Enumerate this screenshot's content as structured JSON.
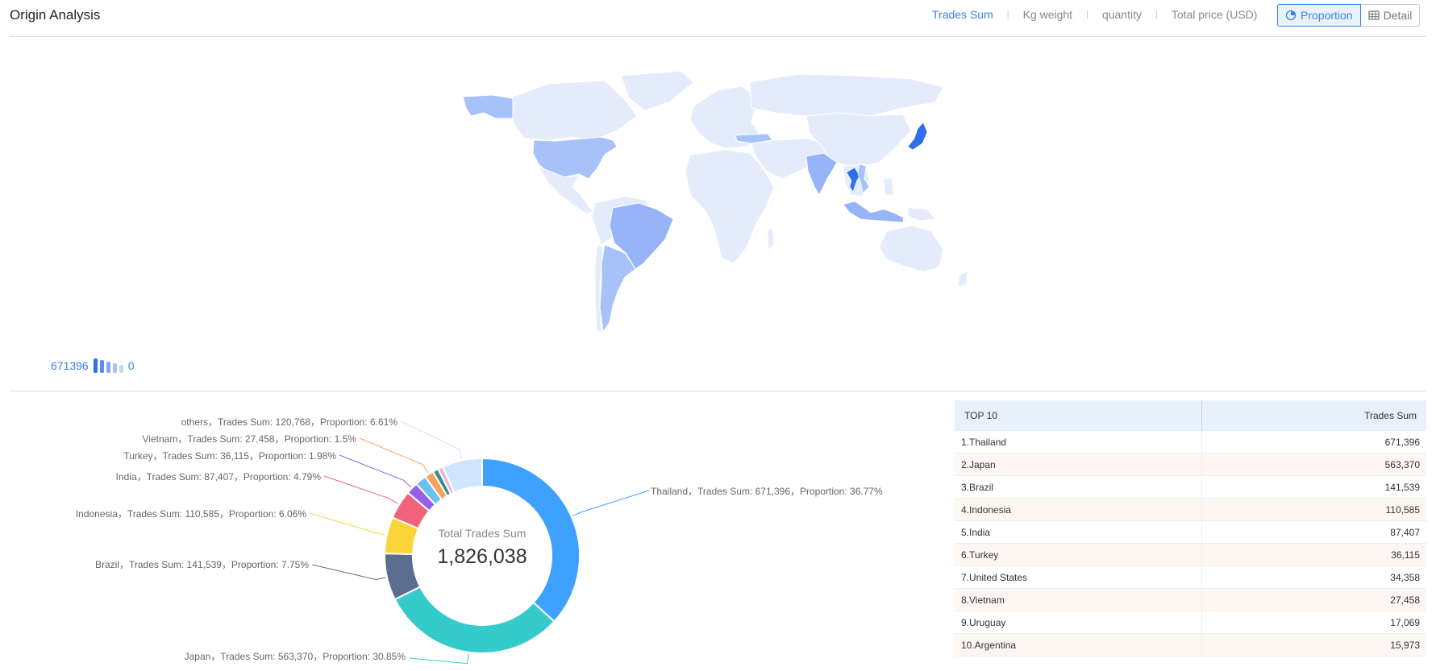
{
  "header": {
    "title": "Origin Analysis",
    "metric_tabs": [
      "Trades Sum",
      "Kg weight",
      "quantity",
      "Total price (USD)"
    ],
    "view_buttons": [
      "Proportion",
      "Detail"
    ]
  },
  "map": {
    "legend_max": "671396",
    "legend_min": "0",
    "highlighted_countries": [
      "Thailand",
      "Japan",
      "Brazil",
      "Indonesia",
      "India",
      "Turkey",
      "United States",
      "Vietnam",
      "Uruguay",
      "Argentina"
    ]
  },
  "donut": {
    "center_label": "Total Trades Sum",
    "center_value": "1,826,038",
    "labels": [
      "Thailand，Trades Sum: 671,396，Proportion: 36.77%",
      "Japan，Trades Sum: 563,370，Proportion: 30.85%",
      "Brazil，Trades Sum: 141,539，Proportion: 7.75%",
      "Indonesia，Trades Sum: 110,585，Proportion: 6.06%",
      "India，Trades Sum: 87,407，Proportion: 4.79%",
      "Turkey，Trades Sum: 36,115，Proportion: 1.98%",
      "Vietnam，Trades Sum: 27,458，Proportion: 1.5%",
      "others，Trades Sum: 120,768，Proportion: 6.61%"
    ]
  },
  "chart_data": {
    "type": "pie",
    "title": "Total Trades Sum",
    "total": 1826038,
    "slices": [
      {
        "name": "Thailand",
        "value": 671396,
        "proportion": 36.77,
        "color": "#3fa1ff"
      },
      {
        "name": "Japan",
        "value": 563370,
        "proportion": 30.85,
        "color": "#36cbcb"
      },
      {
        "name": "Brazil",
        "value": 141539,
        "proportion": 7.75,
        "color": "#5b6e8f"
      },
      {
        "name": "Indonesia",
        "value": 110585,
        "proportion": 6.06,
        "color": "#fbd437"
      },
      {
        "name": "India",
        "value": 87407,
        "proportion": 4.79,
        "color": "#f2637b"
      },
      {
        "name": "Turkey",
        "value": 36115,
        "proportion": 1.98,
        "color": "#975fe5"
      },
      {
        "name": "United States",
        "value": 34358,
        "proportion": 1.88,
        "color": "#6bc1f0"
      },
      {
        "name": "Vietnam",
        "value": 27458,
        "proportion": 1.5,
        "color": "#f7a35c"
      },
      {
        "name": "Uruguay",
        "value": 17069,
        "proportion": 0.93,
        "color": "#3b8c8c"
      },
      {
        "name": "Argentina",
        "value": 15973,
        "proportion": 0.87,
        "color": "#ecb8d8"
      },
      {
        "name": "others",
        "value": 120768,
        "proportion": 6.61,
        "color": "#cfe5fd"
      }
    ]
  },
  "top_table": {
    "header_rank": "TOP 10",
    "header_value": "Trades Sum",
    "rows": [
      {
        "name": "1.Thailand",
        "value": "671,396"
      },
      {
        "name": "2.Japan",
        "value": "563,370"
      },
      {
        "name": "3.Brazil",
        "value": "141,539"
      },
      {
        "name": "4.Indonesia",
        "value": "110,585"
      },
      {
        "name": "5.India",
        "value": "87,407"
      },
      {
        "name": "6.Turkey",
        "value": "36,115"
      },
      {
        "name": "7.United States",
        "value": "34,358"
      },
      {
        "name": "8.Vietnam",
        "value": "27,458"
      },
      {
        "name": "9.Uruguay",
        "value": "17,069"
      },
      {
        "name": "10.Argentina",
        "value": "15,973"
      }
    ]
  },
  "colors": {
    "accent": "#3a82e6",
    "map_base": "#e4ecfb",
    "map_mid": "#a6c2f8",
    "map_high": "#2e6fe8"
  }
}
